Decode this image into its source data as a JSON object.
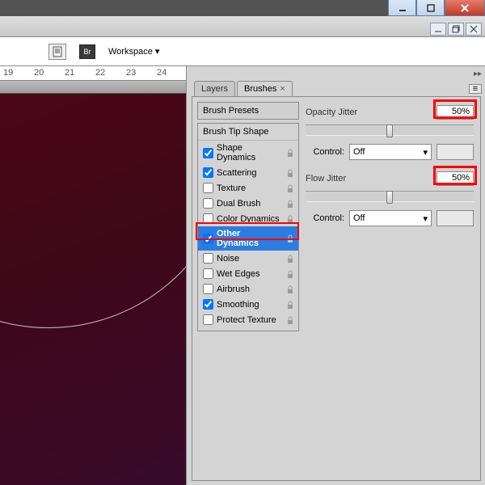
{
  "window": {
    "min": "—",
    "max": "□",
    "close": "✕"
  },
  "toolbar": {
    "workspace_label": "Workspace ▾",
    "br_label": "Br"
  },
  "ruler": {
    "t1": "19",
    "t2": "20",
    "t3": "21",
    "t4": "22",
    "t5": "23",
    "t6": "24"
  },
  "tabs": {
    "layers": "Layers",
    "brushes": "Brushes"
  },
  "panel": {
    "brush_presets": "Brush Presets",
    "brush_tip_shape": "Brush Tip Shape",
    "options": [
      {
        "label": "Shape Dynamics",
        "checked": true
      },
      {
        "label": "Scattering",
        "checked": true
      },
      {
        "label": "Texture",
        "checked": false
      },
      {
        "label": "Dual Brush",
        "checked": false
      },
      {
        "label": "Color Dynamics",
        "checked": false
      },
      {
        "label": "Other Dynamics",
        "checked": true,
        "selected": true
      },
      {
        "label": "Noise",
        "checked": false
      },
      {
        "label": "Wet Edges",
        "checked": false
      },
      {
        "label": "Airbrush",
        "checked": false
      },
      {
        "label": "Smoothing",
        "checked": true
      },
      {
        "label": "Protect Texture",
        "checked": false
      }
    ]
  },
  "settings": {
    "opacity_jitter_label": "Opacity Jitter",
    "opacity_jitter_value": "50%",
    "flow_jitter_label": "Flow Jitter",
    "flow_jitter_value": "50%",
    "control_label": "Control:",
    "control_value": "Off"
  },
  "icons": {
    "arrow_dd": "▾",
    "menu": "≡",
    "caret": "▸▸"
  }
}
